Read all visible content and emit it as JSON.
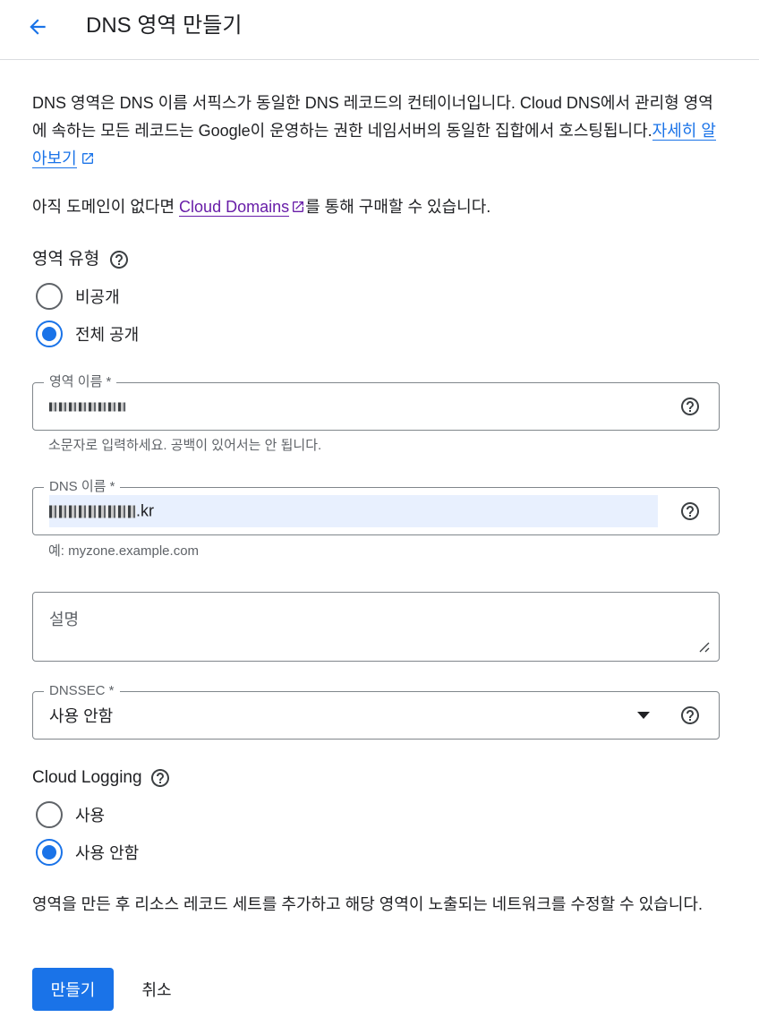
{
  "header": {
    "title": "DNS 영역 만들기",
    "back_icon": "arrow-back-icon"
  },
  "intro": {
    "text": "DNS 영역은 DNS 이름 서픽스가 동일한 DNS 레코드의 컨테이너입니다. Cloud DNS에서 관리형 영역에 속하는 모든 레코드는 Google이 운영하는 권한 네임서버의 동일한 집합에서 호스팅됩니다.",
    "link_label": "자세히 알아보기"
  },
  "domains_note": {
    "prefix": "아직 도메인이 없다면 ",
    "link_label": "Cloud Domains",
    "suffix": "를 통해 구매할 수 있습니다."
  },
  "zone_type": {
    "label": "영역 유형",
    "options": [
      {
        "label": "비공개",
        "checked": false
      },
      {
        "label": "전체 공개",
        "checked": true
      }
    ]
  },
  "zone_name": {
    "label": "영역 이름 *",
    "hint": "소문자로 입력하세요. 공백이 있어서는 안 됩니다."
  },
  "dns_name": {
    "label": "DNS 이름 *",
    "suffix": ".kr",
    "hint": "예: myzone.example.com"
  },
  "description": {
    "placeholder": "설명",
    "value": ""
  },
  "dnssec": {
    "label": "DNSSEC *",
    "value": "사용 안함"
  },
  "cloud_logging": {
    "label": "Cloud Logging",
    "options": [
      {
        "label": "사용",
        "checked": false
      },
      {
        "label": "사용 안함",
        "checked": true
      }
    ]
  },
  "footer_note": "영역을 만든 후 리소스 레코드 세트를 추가하고 해당 영역이 노출되는 네트워크를 수정할 수 있습니다.",
  "actions": {
    "create_label": "만들기",
    "cancel_label": "취소"
  },
  "colors": {
    "primary": "#1a73e8",
    "visited_link": "#681da8",
    "border": "#80868b"
  }
}
